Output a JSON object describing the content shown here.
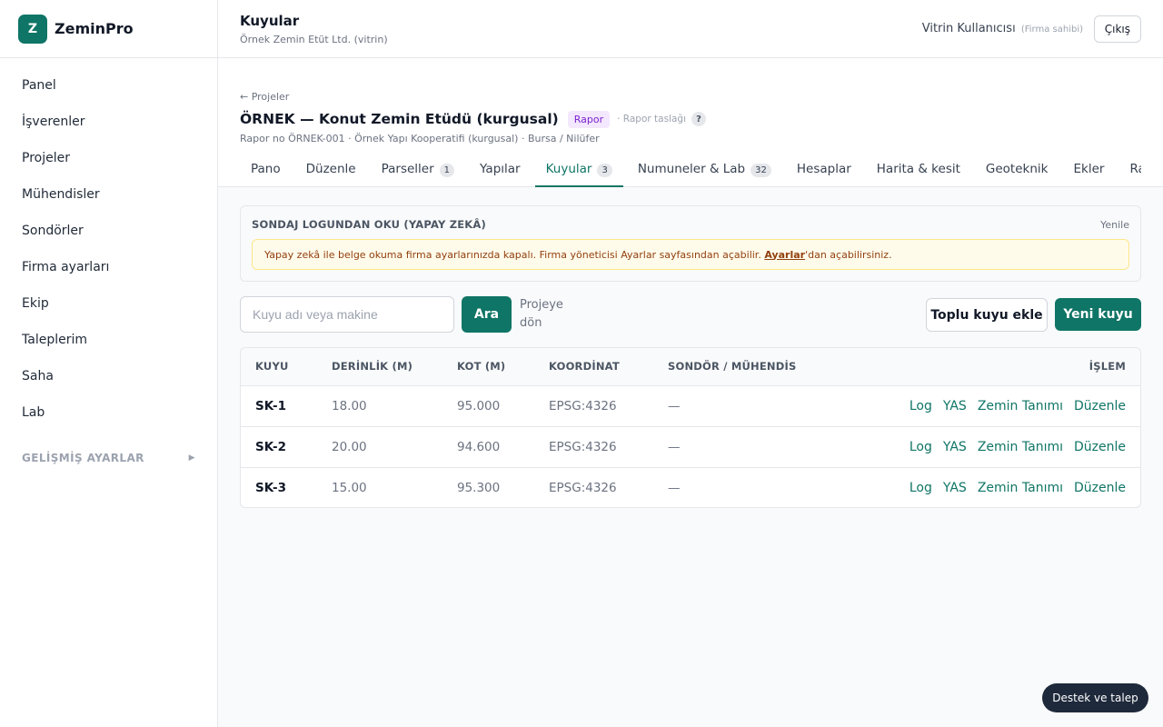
{
  "brand": {
    "logo_letter": "Z",
    "name": "ZeminPro"
  },
  "sidebar": {
    "items": [
      {
        "label": "Panel"
      },
      {
        "label": "İşverenler"
      },
      {
        "label": "Projeler"
      },
      {
        "label": "Mühendisler"
      },
      {
        "label": "Sondörler"
      },
      {
        "label": "Firma ayarları"
      },
      {
        "label": "Ekip"
      },
      {
        "label": "Taleplerim"
      },
      {
        "label": "Saha"
      },
      {
        "label": "Lab"
      }
    ],
    "advanced": {
      "label": "GELİŞMİŞ AYARLAR",
      "icon": "caret-right-icon"
    }
  },
  "header": {
    "title": "Kuyular",
    "subtitle": "Örnek Zemin Etüt Ltd. (vitrin)",
    "user_name": "Vitrin Kullanıcısı",
    "user_role": "(Firma sahibi)",
    "logout_label": "Çıkış"
  },
  "project": {
    "back_label": "← Projeler",
    "title": "ÖRNEK — Konut Zemin Etüdü (kurgusal)",
    "badge": "Rapor",
    "draft": "· Rapor taslağı",
    "help": "?",
    "meta": "Rapor no ÖRNEK-001 · Örnek Yapı Kooperatifi (kurgusal) · Bursa / Nilüfer",
    "tabs": [
      {
        "label": "Pano",
        "count": ""
      },
      {
        "label": "Düzenle",
        "count": ""
      },
      {
        "label": "Parseller",
        "count": "1"
      },
      {
        "label": "Yapılar",
        "count": ""
      },
      {
        "label": "Kuyular",
        "count": "3"
      },
      {
        "label": "Numuneler & Lab",
        "count": "32"
      },
      {
        "label": "Hesaplar",
        "count": ""
      },
      {
        "label": "Harita & kesit",
        "count": ""
      },
      {
        "label": "Geoteknik",
        "count": ""
      },
      {
        "label": "Ekler",
        "count": ""
      },
      {
        "label": "Rapor",
        "count": ""
      }
    ],
    "active_tab": "Kuyular"
  },
  "ai_panel": {
    "title": "SONDAJ LOGUNDAN OKU (YAPAY ZEKÂ)",
    "refresh_label": "Yenile",
    "warning_text": "Yapay zekâ ile belge okuma firma ayarlarınızda kapalı. Firma yöneticisi Ayarlar sayfasından açabilir. ",
    "warning_link": "Ayarlar",
    "warning_suffix": "'dan açabilirsiniz."
  },
  "toolbar": {
    "search_value": "",
    "search_placeholder": "Kuyu adı veya makine",
    "search_button": "Ara",
    "back_to_project": "Projeye dön",
    "bulk_add": "Toplu kuyu ekle",
    "new_well": "Yeni kuyu"
  },
  "table": {
    "columns": [
      "KUYU",
      "DERİNLİK (M)",
      "KOT (M)",
      "KOORDİNAT",
      "SONDÖR / MÜHENDİS",
      "İŞLEM"
    ],
    "rows": [
      {
        "name": "SK-1",
        "depth": "18.00",
        "elevation": "95.000",
        "coord": "EPSG:4326",
        "driller": "—"
      },
      {
        "name": "SK-2",
        "depth": "20.00",
        "elevation": "94.600",
        "coord": "EPSG:4326",
        "driller": "—"
      },
      {
        "name": "SK-3",
        "depth": "15.00",
        "elevation": "95.300",
        "coord": "EPSG:4326",
        "driller": "—"
      }
    ],
    "actions": [
      "Log",
      "YAS",
      "Zemin Tanımı",
      "Düzenle"
    ]
  },
  "help_button": "Destek ve talep",
  "colors": {
    "accent": "#0f7566",
    "badge_bg": "#f3e8ff",
    "badge_text": "#7e22ce",
    "warning_bg": "#fffbeb",
    "warning_text": "#92400e"
  }
}
